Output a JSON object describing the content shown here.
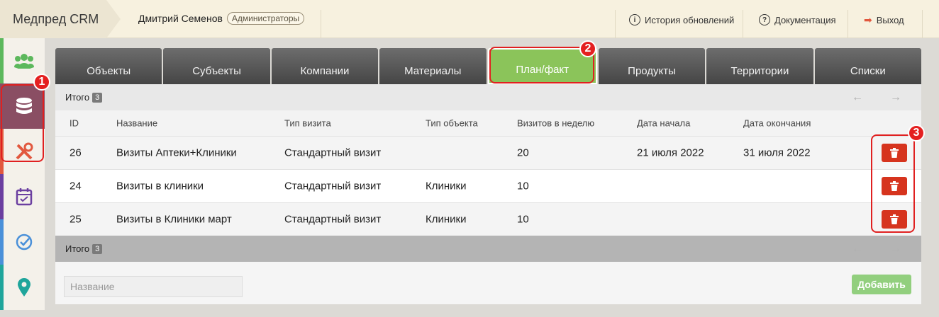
{
  "app": {
    "title": "Медпред CRM"
  },
  "user": {
    "name": "Дмитрий Семенов",
    "role": "Администраторы"
  },
  "toplinks": {
    "updates": "История обновлений",
    "docs": "Документация",
    "logout": "Выход"
  },
  "rail": {
    "items": [
      {
        "icon": "users-icon",
        "color": "#5cb85c"
      },
      {
        "icon": "database-icon",
        "color": "#8a4e63",
        "active": true
      },
      {
        "icon": "tools-icon",
        "color": "#e2583e"
      },
      {
        "icon": "calendar-check-icon",
        "color": "#6b3fa0"
      },
      {
        "icon": "check-circle-icon",
        "color": "#4a90d9"
      },
      {
        "icon": "map-pin-icon",
        "color": "#1fa59b"
      }
    ]
  },
  "markers": {
    "m1": "1",
    "m2": "2",
    "m3": "3"
  },
  "tabs": [
    {
      "label": "Объекты"
    },
    {
      "label": "Субъекты"
    },
    {
      "label": "Компании"
    },
    {
      "label": "Материалы"
    },
    {
      "label": "План/факт",
      "active": true
    },
    {
      "label": "Продукты"
    },
    {
      "label": "Территории"
    },
    {
      "label": "Списки"
    }
  ],
  "totals": {
    "label": "Итого",
    "count": "3",
    "prev": "←",
    "next": "→"
  },
  "table": {
    "headers": {
      "id": "ID",
      "name": "Название",
      "visit_type": "Тип визита",
      "object_type": "Тип объекта",
      "per_week": "Визитов в неделю",
      "start": "Дата начала",
      "end": "Дата окончания"
    },
    "rows": [
      {
        "id": "26",
        "name": "Визиты Аптеки+Клиники",
        "visit_type": "Стандартный визит",
        "object_type": "",
        "per_week": "20",
        "start": "21 июля 2022",
        "end": "31 июля 2022"
      },
      {
        "id": "24",
        "name": "Визиты в клиники",
        "visit_type": "Стандартный визит",
        "object_type": "Клиники",
        "per_week": "10",
        "start": "",
        "end": ""
      },
      {
        "id": "25",
        "name": "Визиты в Клиники март",
        "visit_type": "Стандартный визит",
        "object_type": "Клиники",
        "per_week": "10",
        "start": "",
        "end": ""
      }
    ]
  },
  "form": {
    "name_placeholder": "Название",
    "add_label": "Добавить"
  },
  "colors": {
    "accent_green": "#8bc45a",
    "danger": "#d6341e",
    "marker": "#e42020"
  }
}
